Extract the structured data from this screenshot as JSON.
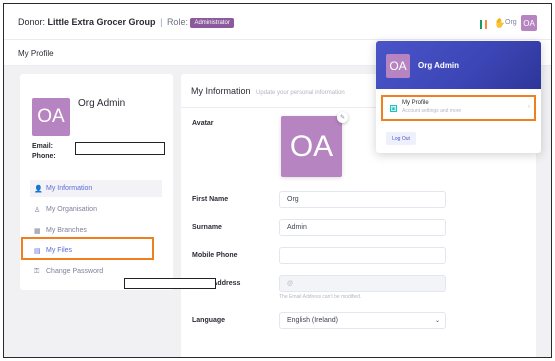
{
  "topbar": {
    "donor_label": "Donor:",
    "org_name": "Little Extra Grocer Group",
    "separator": "|",
    "role_label": "Role:",
    "role_badge": "Administrator",
    "user_short": "Org",
    "avatar_initials": "OA",
    "flag_colors": [
      "#169b62",
      "#ffffff",
      "#ff883e"
    ]
  },
  "subheader": {
    "title": "My Profile"
  },
  "profile_card": {
    "avatar_initials": "OA",
    "name": "Org Admin",
    "email_label": "Email:",
    "phone_label": "Phone:",
    "menu": [
      {
        "icon": "user-icon",
        "label": "My Information",
        "active": true
      },
      {
        "icon": "organisation-icon",
        "label": "My Organisation"
      },
      {
        "icon": "branches-icon",
        "label": "My Branches"
      },
      {
        "icon": "files-icon",
        "label": "My Files"
      },
      {
        "icon": "key-icon",
        "label": "Change Password"
      }
    ]
  },
  "info_card": {
    "title": "My Information",
    "subtitle": "Update your personal information",
    "avatar_label": "Avatar",
    "avatar_initials": "OA",
    "first_name_label": "First Name",
    "first_name_value": "Org",
    "surname_label": "Surname",
    "surname_value": "Admin",
    "mobile_label": "Mobile Phone",
    "mobile_value": "",
    "email_label": "Email Address",
    "email_help": "The Email Address can't be modified.",
    "language_label": "Language",
    "language_value": "English (Ireland)"
  },
  "user_dropdown": {
    "avatar_initials": "OA",
    "name": "Org Admin",
    "item_title": "My Profile",
    "item_subtitle": "Account settings and more",
    "logout_label": "Log Out"
  },
  "colors": {
    "avatar_bg": "#b784c2",
    "accent": "#5c6bd6",
    "highlight": "#f07f1f",
    "dropdown_header": "#4a55c8"
  }
}
